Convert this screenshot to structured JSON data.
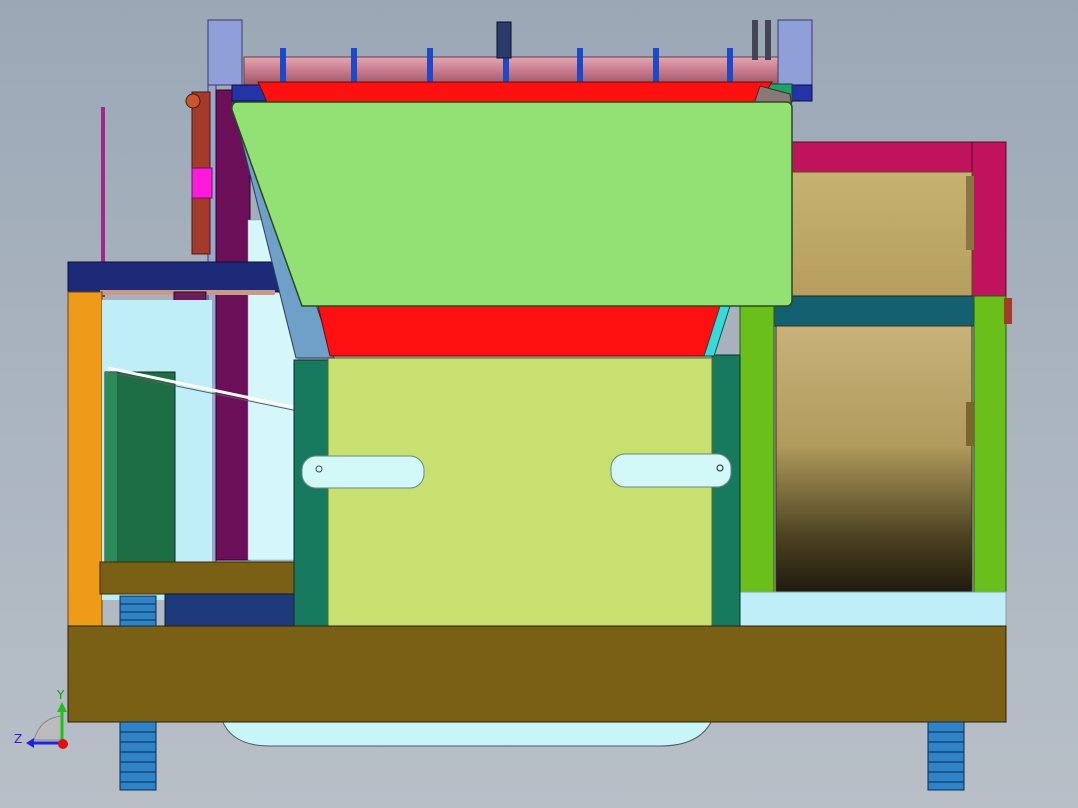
{
  "viewport": {
    "background": "#a3aebb"
  },
  "triad": {
    "y_label": "Y",
    "z_label": "Z",
    "y_axis_color": "#1fbf1f",
    "z_axis_color": "#2323d6",
    "x_axis_color": "#e01010"
  },
  "model": {
    "base_plate_color": "#7a6014",
    "hopper_front_color": "#93e074",
    "hopper_rim_color": "#ff1010",
    "drum_panel_color": "#c8e070",
    "right_frame_color": "#6abf1a",
    "roller_color": "#c2a862",
    "top_roller_color": "#c77a8c",
    "magenta_frame_color": "#c0135e",
    "left_post_color": "#ee9b1a",
    "wheel_color": "#2f84c8"
  }
}
